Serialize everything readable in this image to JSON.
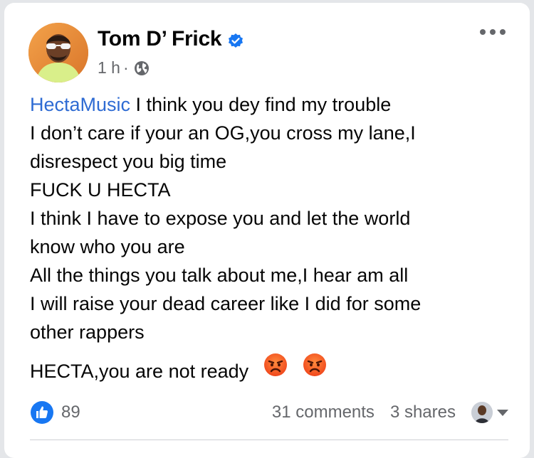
{
  "post": {
    "author": "Tom D’ Frick",
    "time": "1 h",
    "separator": "·",
    "mention": "HectaMusic",
    "lines": [
      " I think you dey find my trouble",
      "I don’t care if your an OG,you cross my lane,I",
      "disrespect you big time",
      "FUCK U HECTA",
      "I think I have to expose you and let the world",
      "know who you are",
      "All the things you talk about me,I hear am all",
      "I will raise your dead career like I did for some",
      "other rappers"
    ],
    "last_line": "HECTA,you are not ready",
    "emojis": [
      "angry-face-emoji",
      "angry-face-emoji"
    ]
  },
  "footer": {
    "like_count": "89",
    "comments": "31 comments",
    "shares": "3 shares"
  },
  "colors": {
    "mention": "#2e6bd3",
    "verified": "#1877f2",
    "like": "#1877f2",
    "muted": "#65676b"
  },
  "icons": {
    "verified": "verified-badge-icon",
    "audience": "globe-icon",
    "more": "more-options-icon",
    "like": "like-icon",
    "dropdown": "chevron-down-icon"
  }
}
